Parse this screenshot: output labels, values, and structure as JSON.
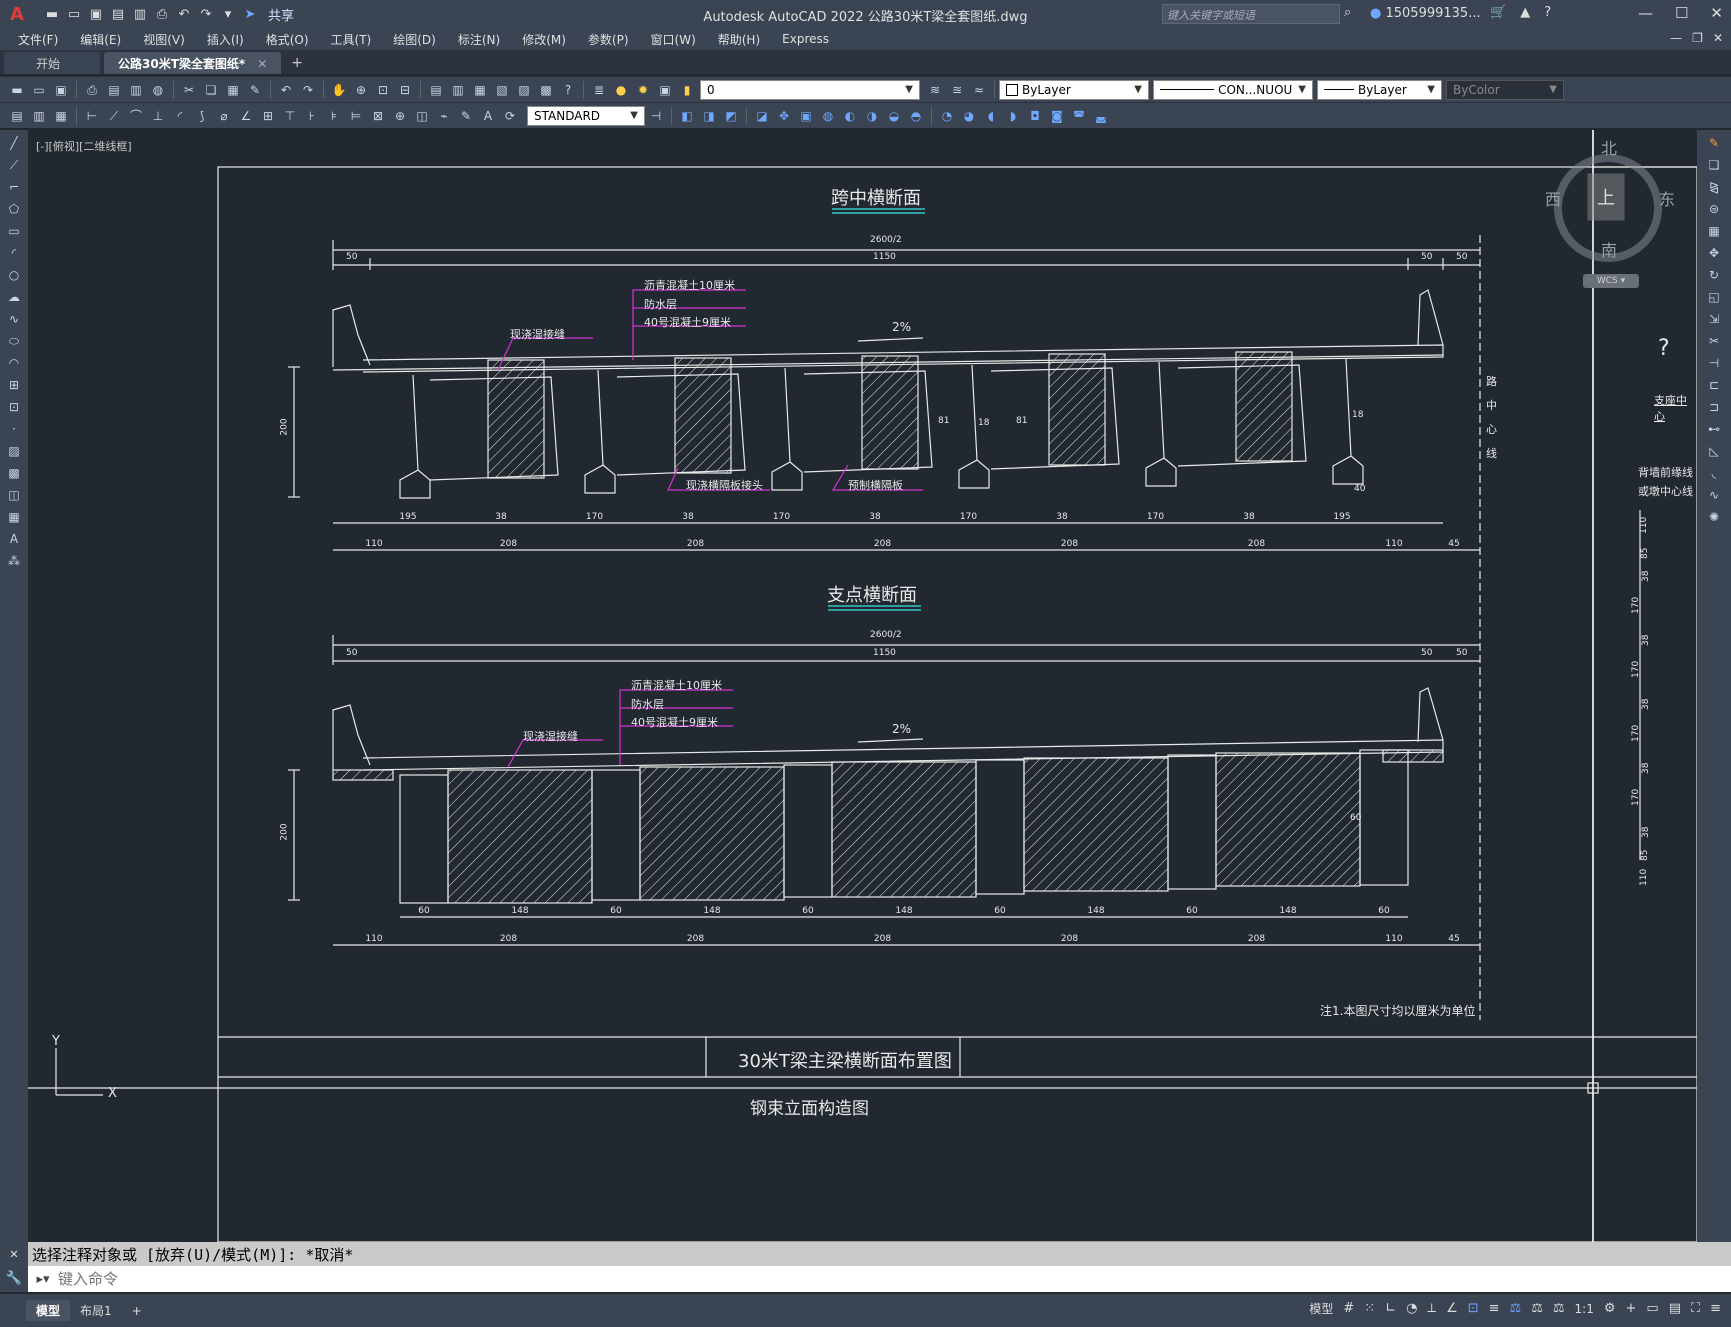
{
  "app": {
    "title": "Autodesk AutoCAD 2022    公路30米T梁全套图纸.dwg",
    "share": "共享",
    "search_placeholder": "键入关键字或短语",
    "user": "1505999135...",
    "logo": "A"
  },
  "menu": [
    "文件(F)",
    "编辑(E)",
    "视图(V)",
    "插入(I)",
    "格式(O)",
    "工具(T)",
    "绘图(D)",
    "标注(N)",
    "修改(M)",
    "参数(P)",
    "窗口(W)",
    "帮助(H)",
    "Express"
  ],
  "tabs": [
    {
      "label": "开始",
      "active": false
    },
    {
      "label": "公路30米T梁全套图纸*",
      "active": true
    }
  ],
  "toolbar": {
    "layer_value": "0",
    "color_value": "ByLayer",
    "linetype_value": "CON...NUOU",
    "lineweight_value": "ByLayer",
    "plotstyle_value": "ByColor",
    "textstyle_value": "STANDARD"
  },
  "viewport": {
    "label": "[-][俯视][二维线框]",
    "viewcube": {
      "north": "北",
      "south": "南",
      "east": "东",
      "west": "西",
      "top": "上",
      "wcs": "WCS"
    }
  },
  "drawing": {
    "title1": "跨中横断面",
    "title2": "支点横断面",
    "total_width": "2600/2",
    "dim_50": "50",
    "dim_1150": "1150",
    "dim_200": "200",
    "layers": [
      "沥青混凝土10厘米",
      "防水层",
      "40号混凝土9厘米"
    ],
    "slope": "2%",
    "joint_cast": "现浇湿接缝",
    "diaphragm_joint": "现浇横隔板接头",
    "precast_diaphragm": "预制横隔板",
    "road_center": "路中心线",
    "dim_81": "81",
    "dim_18": "18",
    "dim_40": "40",
    "dim_60": "60",
    "bottom_row1": [
      "195",
      "38",
      "170",
      "38",
      "170",
      "38",
      "170",
      "38",
      "170",
      "38",
      "195"
    ],
    "bottom_row2": [
      "110",
      "208",
      "208",
      "208",
      "208",
      "208",
      "110",
      "45"
    ],
    "support_row1": [
      "60",
      "148",
      "60",
      "148",
      "60",
      "148",
      "60",
      "148",
      "60",
      "148",
      "60"
    ],
    "note": "注1.本图尺寸均以厘米为单位",
    "frame_title": "30米T梁主梁横断面布置图",
    "frame_bottom": "钢束立面构造图",
    "side_label1": "支座中心",
    "side_label2": "背墙前缘线",
    "side_label3": "或墩中心线",
    "side_dims": [
      "110",
      "85",
      "38",
      "170",
      "38",
      "170",
      "38",
      "170",
      "38",
      "170",
      "38",
      "85",
      "110"
    ]
  },
  "command": {
    "history": "选择注释对象或 [放弃(U)/模式(M)]: *取消*",
    "placeholder": "键入命令"
  },
  "status": {
    "layout_tabs": [
      "模型",
      "布局1"
    ],
    "model_label": "模型",
    "scale": "1:1"
  }
}
